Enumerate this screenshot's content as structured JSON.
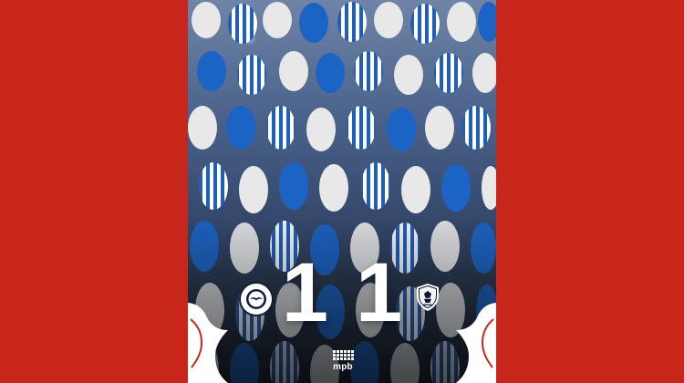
{
  "score": {
    "home": "1",
    "away": "1"
  },
  "teams": {
    "home_badge_icon": "brighton-seagull-icon",
    "away_badge_icon": "leeds-shield-icon"
  },
  "sponsor": {
    "wordmark": "mpb",
    "logo_icon": "mpb-dot-grid-icon"
  },
  "colors": {
    "background_red": "#c8261b",
    "accent_blue": "#0f5bb5"
  }
}
